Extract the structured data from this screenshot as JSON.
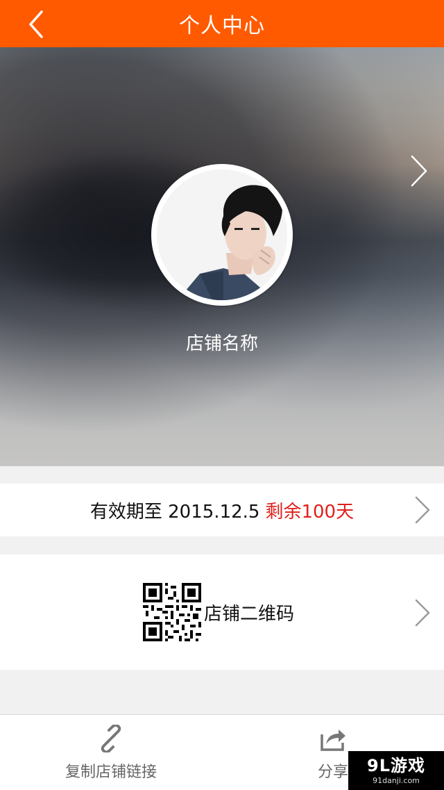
{
  "header": {
    "title": "个人中心",
    "accent_color": "#ff5a00",
    "back_icon": "chevron-left-icon"
  },
  "profile": {
    "store_name": "店铺名称",
    "next_icon": "chevron-right-icon"
  },
  "validity": {
    "prefix": "有效期至 2015.12.5",
    "remaining": "剩余100天",
    "remaining_color": "#e0201c"
  },
  "qrcode": {
    "label": "店铺二维码",
    "icon": "qr-code-icon"
  },
  "bottom_bar": {
    "copy_label": "复制店铺链接",
    "copy_icon": "link-icon",
    "share_label": "分享",
    "share_icon": "share-icon"
  },
  "watermark": {
    "text": "9L游戏",
    "sub": "91danji.com"
  }
}
